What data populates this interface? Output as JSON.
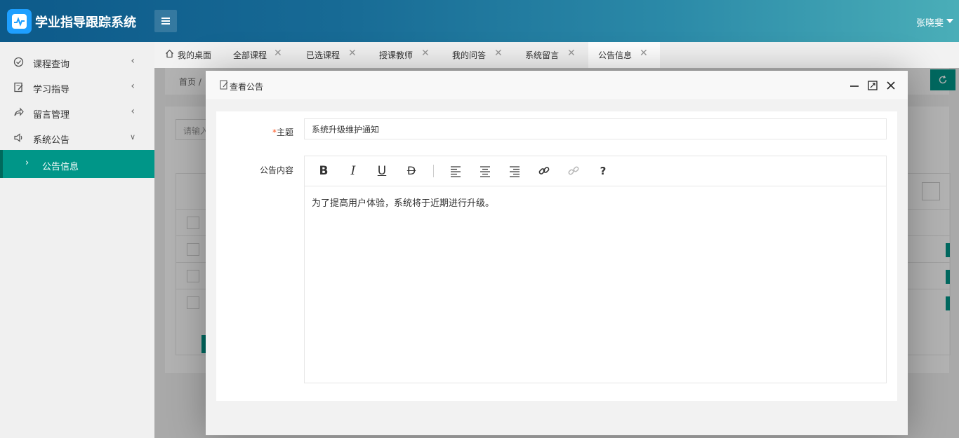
{
  "header": {
    "app_title": "学业指导跟踪系统",
    "user_name": "张晓斐"
  },
  "sidebar": {
    "items": [
      {
        "label": "课程查询",
        "icon": "check-circle-icon",
        "arrow": "chevron-left"
      },
      {
        "label": "学习指导",
        "icon": "edit-note-icon",
        "arrow": "chevron-left"
      },
      {
        "label": "留言管理",
        "icon": "share-icon",
        "arrow": "chevron-left"
      },
      {
        "label": "系统公告",
        "icon": "speaker-icon",
        "arrow": "chevron-down"
      }
    ],
    "active_sub": {
      "label": "公告信息"
    }
  },
  "tabs": [
    {
      "label": "我的桌面",
      "closable": false
    },
    {
      "label": "全部课程",
      "closable": true
    },
    {
      "label": "已选课程",
      "closable": true
    },
    {
      "label": "授课教师",
      "closable": true
    },
    {
      "label": "我的问答",
      "closable": true
    },
    {
      "label": "系统留言",
      "closable": true
    },
    {
      "label": "公告信息",
      "closable": true,
      "active": true
    }
  ],
  "background": {
    "breadcrumb": "首页 /",
    "search_placeholder": "请输入"
  },
  "modal": {
    "title": "查看公告",
    "subject_label": "主题",
    "subject_required_mark": "*",
    "subject_value": "系统升级维护通知",
    "content_label": "公告内容",
    "content_text": "为了提高用户体验，系统将于近期进行升级。",
    "toolbar": [
      "bold",
      "italic",
      "underline",
      "strikethrough",
      "align-left",
      "align-center",
      "align-right",
      "link",
      "unlink",
      "help"
    ],
    "help_glyph": "?"
  },
  "colors": {
    "accent": "#009688",
    "header_start": "#0d5a8a",
    "header_end": "#4aaeb8",
    "logo": "#1e9fff",
    "required": "#ff5722"
  }
}
